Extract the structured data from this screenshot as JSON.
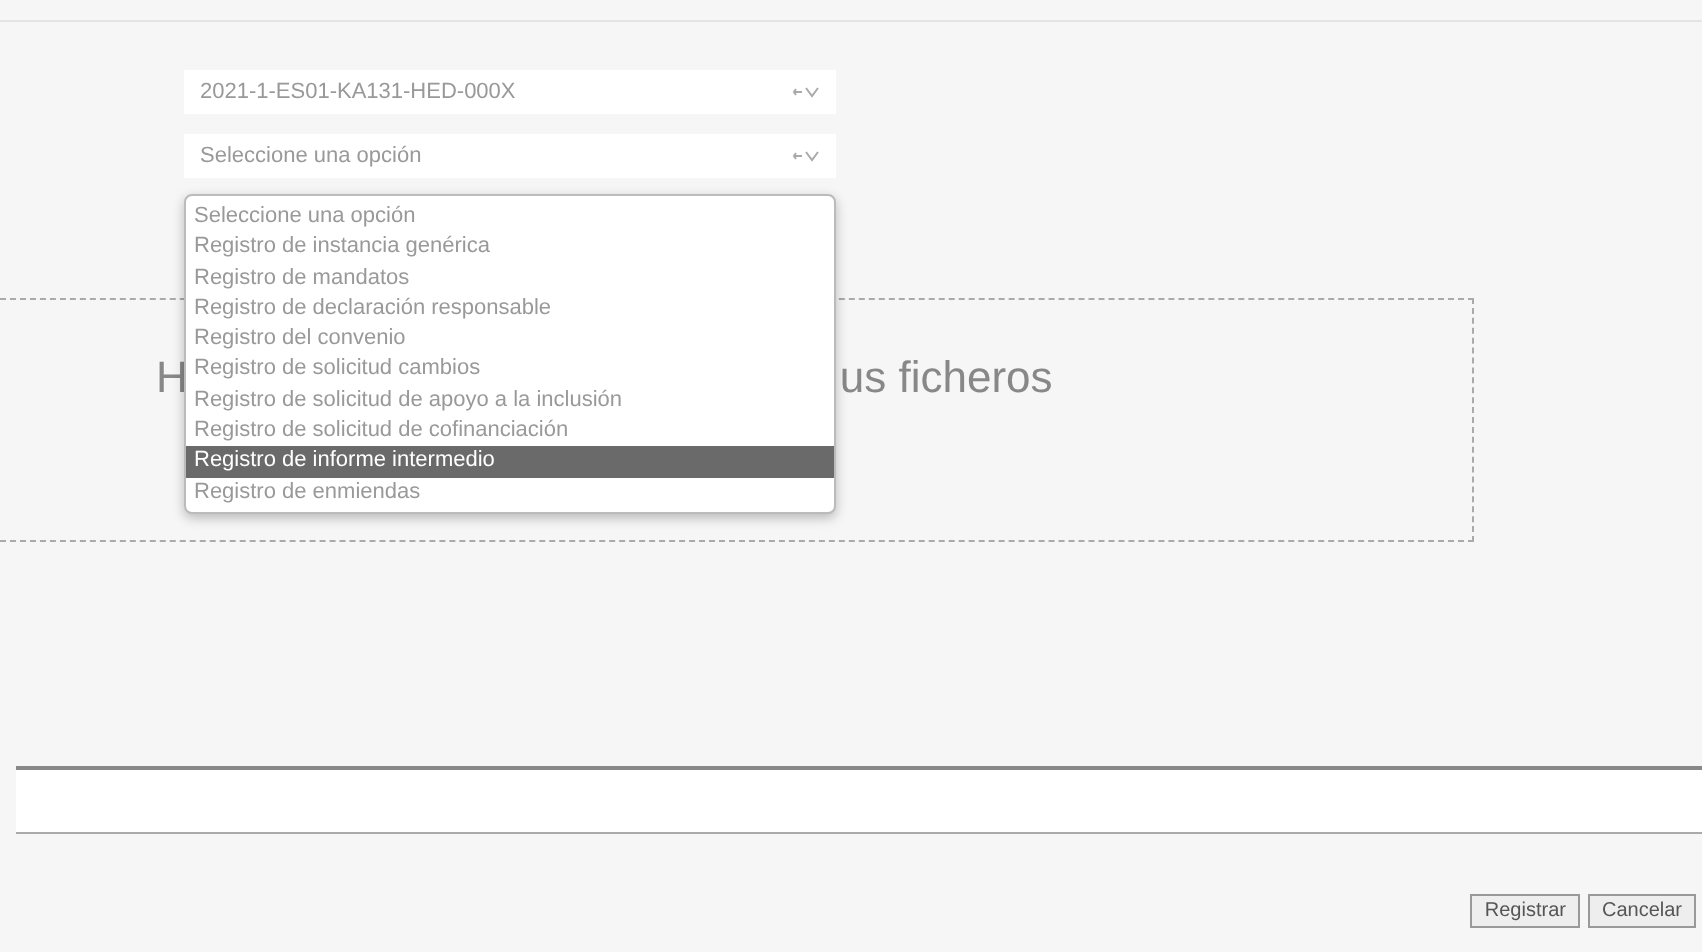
{
  "selects": [
    {
      "value": "2021-1-ES01-KA131-HED-000X"
    },
    {
      "value": "Seleccione una opción"
    }
  ],
  "dropdown": {
    "options": [
      {
        "label": "Seleccione una opción",
        "selected": false
      },
      {
        "label": "Registro de instancia genérica",
        "selected": false
      },
      {
        "label": "Registro de mandatos",
        "selected": false
      },
      {
        "label": "Registro de declaración responsable",
        "selected": false
      },
      {
        "label": "Registro del convenio",
        "selected": false
      },
      {
        "label": "Registro de solicitud cambios",
        "selected": false
      },
      {
        "label": "Registro de solicitud de apoyo a la inclusión",
        "selected": false
      },
      {
        "label": "Registro de solicitud de cofinanciación",
        "selected": false
      },
      {
        "label": "Registro de informe intermedio",
        "selected": true
      },
      {
        "label": "Registro de enmiendas",
        "selected": false
      }
    ]
  },
  "drop_zone": {
    "text_before": "H",
    "text_after": "us ficheros"
  },
  "buttons": [
    "Registrar",
    "Cancelar"
  ]
}
